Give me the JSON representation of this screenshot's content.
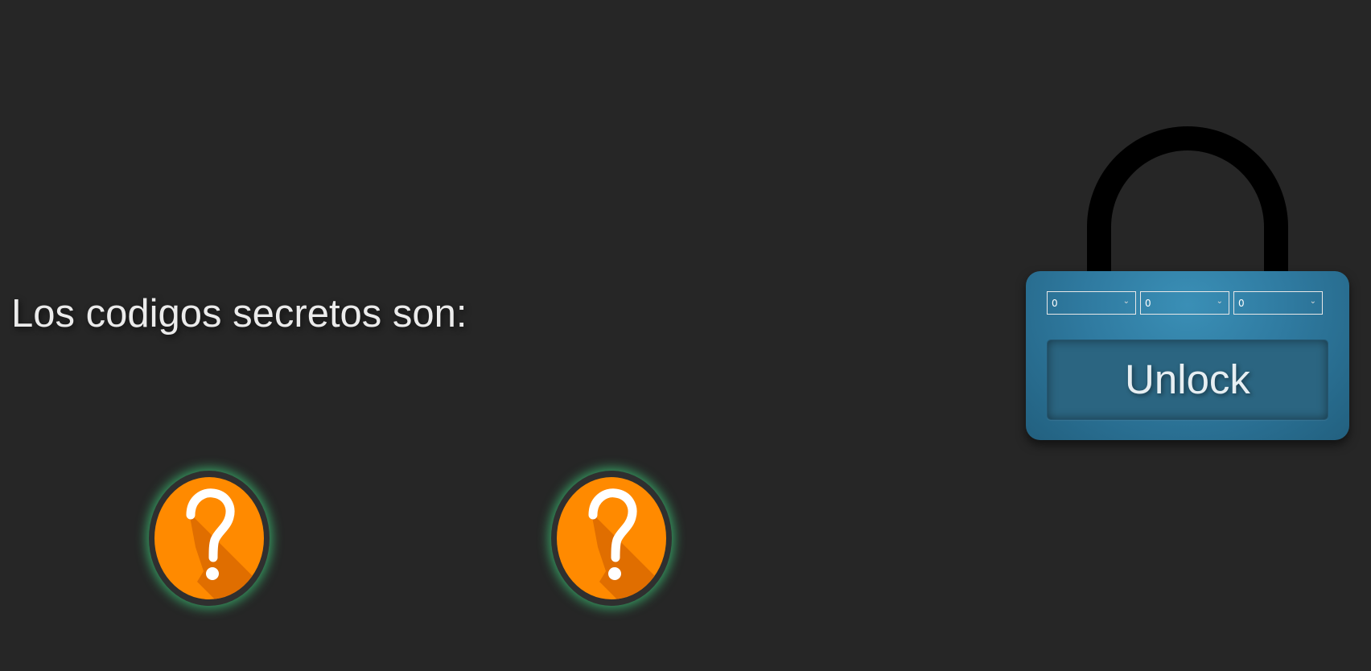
{
  "heading": "Los codigos secretos son:",
  "clues": [
    {
      "icon": "question-mark-icon",
      "symbol": "?"
    },
    {
      "icon": "question-mark-icon",
      "symbol": "?"
    }
  ],
  "lock": {
    "dials": [
      "0",
      "0",
      "0"
    ],
    "unlock_label": "Unlock"
  },
  "colors": {
    "background": "#262626",
    "clue_orange": "#ff8a00",
    "clue_glow": "#3cc878",
    "lock_body": "#2f7aa0",
    "shackle": "#000000"
  }
}
